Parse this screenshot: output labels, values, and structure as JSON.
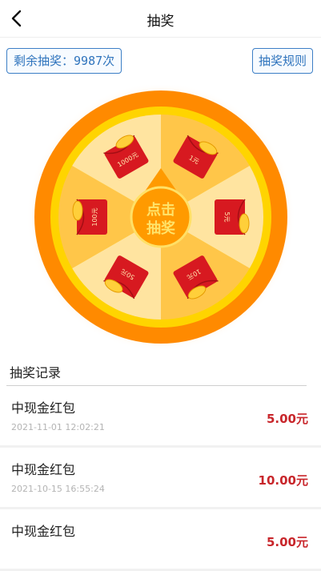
{
  "header": {
    "title": "抽奖",
    "back_icon": "chevron-left-icon"
  },
  "top": {
    "remaining_label": "剩余抽奖：",
    "remaining_count": "9987",
    "remaining_unit": "次",
    "rules_label": "抽奖规则"
  },
  "wheel": {
    "center_line1": "点击",
    "center_line2": "抽奖",
    "prizes": [
      "1元",
      "5元",
      "10元",
      "50元",
      "100元",
      "1000元"
    ],
    "colors": {
      "outer_ring": "#ff8a00",
      "inner_ring": "#ffd400",
      "segment_dark": "#ffc649",
      "segment_light": "#ffe4a0",
      "envelope": "#d71920",
      "pointer": "#ff9a00"
    }
  },
  "records": {
    "title": "抽奖记录",
    "items": [
      {
        "name": "中现金红包",
        "time": "2021-11-01 12:02:21",
        "amount": "5.00元"
      },
      {
        "name": "中现金红包",
        "time": "2021-10-15 16:55:24",
        "amount": "10.00元"
      },
      {
        "name": "中现金红包",
        "time": "",
        "amount": "5.00元"
      }
    ]
  }
}
